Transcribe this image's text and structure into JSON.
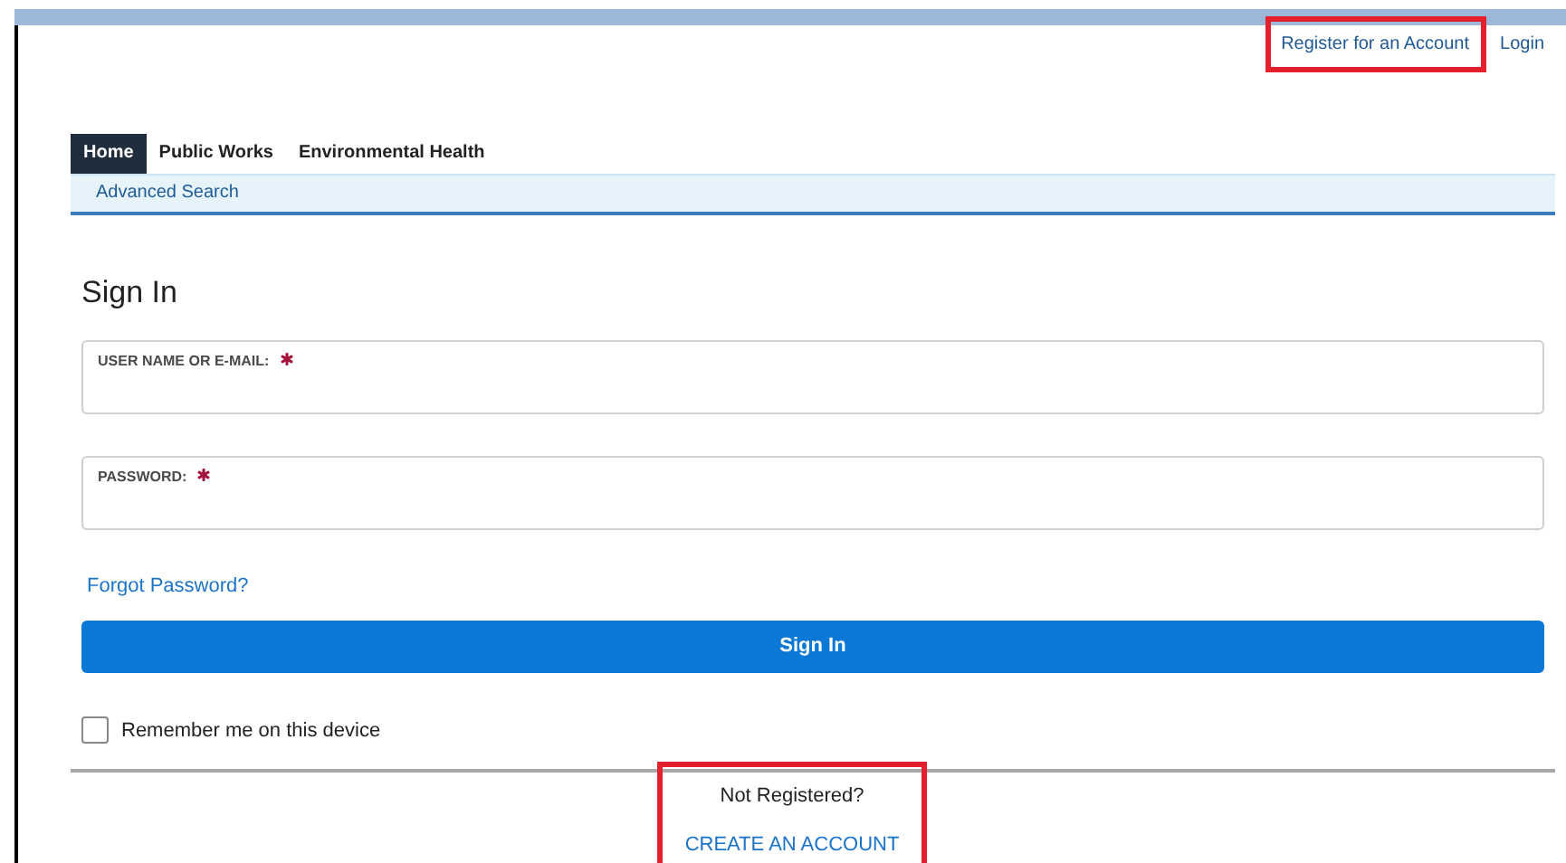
{
  "header_links": [
    {
      "label": "Register for an Account",
      "highlighted": true
    },
    {
      "label": "Login",
      "highlighted": false
    }
  ],
  "tabs": [
    {
      "label": "Home",
      "selected": true
    },
    {
      "label": "Public Works",
      "selected": false
    },
    {
      "label": "Environmental Health",
      "selected": false
    }
  ],
  "subnav": {
    "links": [
      "Advanced Search"
    ]
  },
  "form": {
    "heading": "Sign In",
    "fields": [
      {
        "label": "USER NAME OR E-MAIL:",
        "required": true
      },
      {
        "label": "PASSWORD:",
        "required": true
      }
    ],
    "forgot_link": "Forgot Password?",
    "submit_button": "Sign In",
    "remember": {
      "label": "Remember me on this device",
      "checked": false
    }
  },
  "register": {
    "prompt": "Not Registered?",
    "link": "CREATE AN ACCOUNT",
    "highlighted": true
  }
}
